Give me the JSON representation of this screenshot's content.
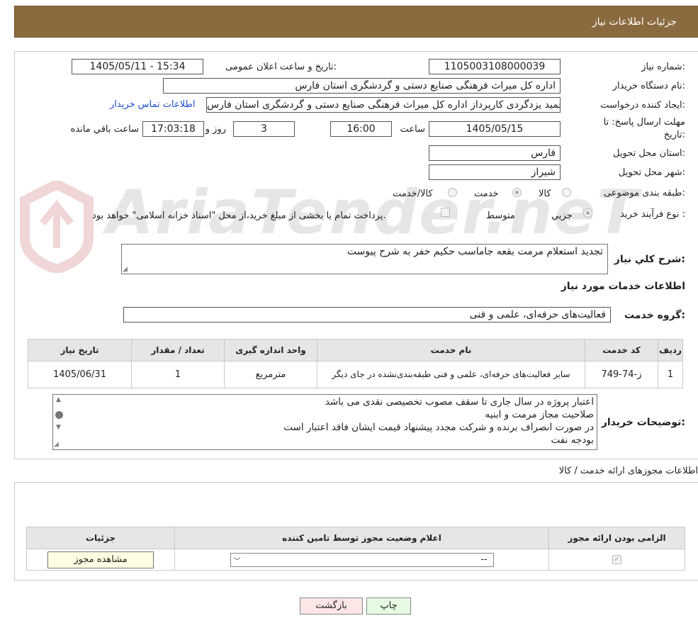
{
  "header": {
    "title": "جزئیات اطلاعات نیاز"
  },
  "watermark": {
    "text": "AriaTender.neT"
  },
  "form": {
    "need_number_label": "شماره نیاز:",
    "need_number": "1105003108000039",
    "announce_label": "تاریخ و ساعت اعلان عمومی:",
    "announce_value": "1405/05/11 - 15:34",
    "buyer_label": "نام دستگاه خریدار:",
    "buyer_value": "اداره کل میراث فرهنگی  صنایع دستی و گردشگری استان فارس",
    "creator_label": "ایجاد کننده درخواست:",
    "creator_value": "سیدحمید یزدگردی کارپرداز اداره کل میراث فرهنگی  صنایع دستی و گردشگری استان فارس",
    "contact_link": "اطلاعات تماس خریدار",
    "deadline_label_1": "مهلت ارسال پاسخ: تا",
    "deadline_label_2": "تاریخ:",
    "deadline_date": "1405/05/15",
    "time_label": "ساعت",
    "deadline_time": "16:00",
    "days_value": "3",
    "days_label": "روز و",
    "remaining_time": "17:03:18",
    "remaining_label": "ساعت باقي مانده",
    "province_label": "استان محل تحویل:",
    "province_value": "فارس",
    "city_label": "شهر محل تحویل:",
    "city_value": "شیراز",
    "category_label": "طبقه بندی موضوعی:",
    "category_options": [
      "کالا",
      "خدمت",
      "کالا/خدمت"
    ],
    "process_label": "نوع فرآیند خرید :",
    "process_options": [
      "جزیي",
      "متوسط"
    ],
    "payment_note": "پرداخت تمام یا بخشی از مبلغ خرید،از محل \"اسناد خزانه اسلامی\" خواهد بود."
  },
  "summary": {
    "label": "شرح کلي نياز:",
    "value": "تجدید استعلام مرمت بقعه جاماسب حکیم خفر به شرح پیوست"
  },
  "services": {
    "section_title": "اطلاعات خدمات مورد نیاز",
    "group_label": "گروه خدمت:",
    "group_value": "فعالیت‌های حرفه‌ای، علمی و فنی",
    "columns": [
      "ردیف",
      "کد خدمت",
      "نام خدمت",
      "واحد اندازه گیری",
      "تعداد / مقدار",
      "تاریخ نیاز"
    ],
    "rows": [
      {
        "idx": "1",
        "code": "ز-74-749",
        "name": "سایر فعالیت‌های حرفه‌ای، علمی و فنی طبقه‌بندی‌نشده در جای دیگر",
        "unit": "مترمربع",
        "qty": "1",
        "date": "1405/06/31"
      }
    ]
  },
  "buyer_notes": {
    "label": "توضیحات خریدار:",
    "lines": [
      "اعتبار پروژه در سال جاری تا سقف مصوب تخصیصی نقدی می باشد",
      "صلاحیت مجاز مرمت و ابنیه",
      "در صورت انصراف برنده  و شرکت مجدد پیشنهاد قیمت ایشان فاقد اعتبار است",
      "بودجه نفت"
    ]
  },
  "permits": {
    "section_title": "اطلاعات مجوزهای ارائه خدمت / کالا",
    "columns": [
      "الزامی بودن ارائه مجوز",
      "اعلام وضعیت مجوز توسط تامین کننده",
      "جزئیات"
    ],
    "select_value": "--",
    "view_button": "مشاهده مجوز"
  },
  "buttons": {
    "print": "چاپ",
    "back": "بازگشت"
  }
}
